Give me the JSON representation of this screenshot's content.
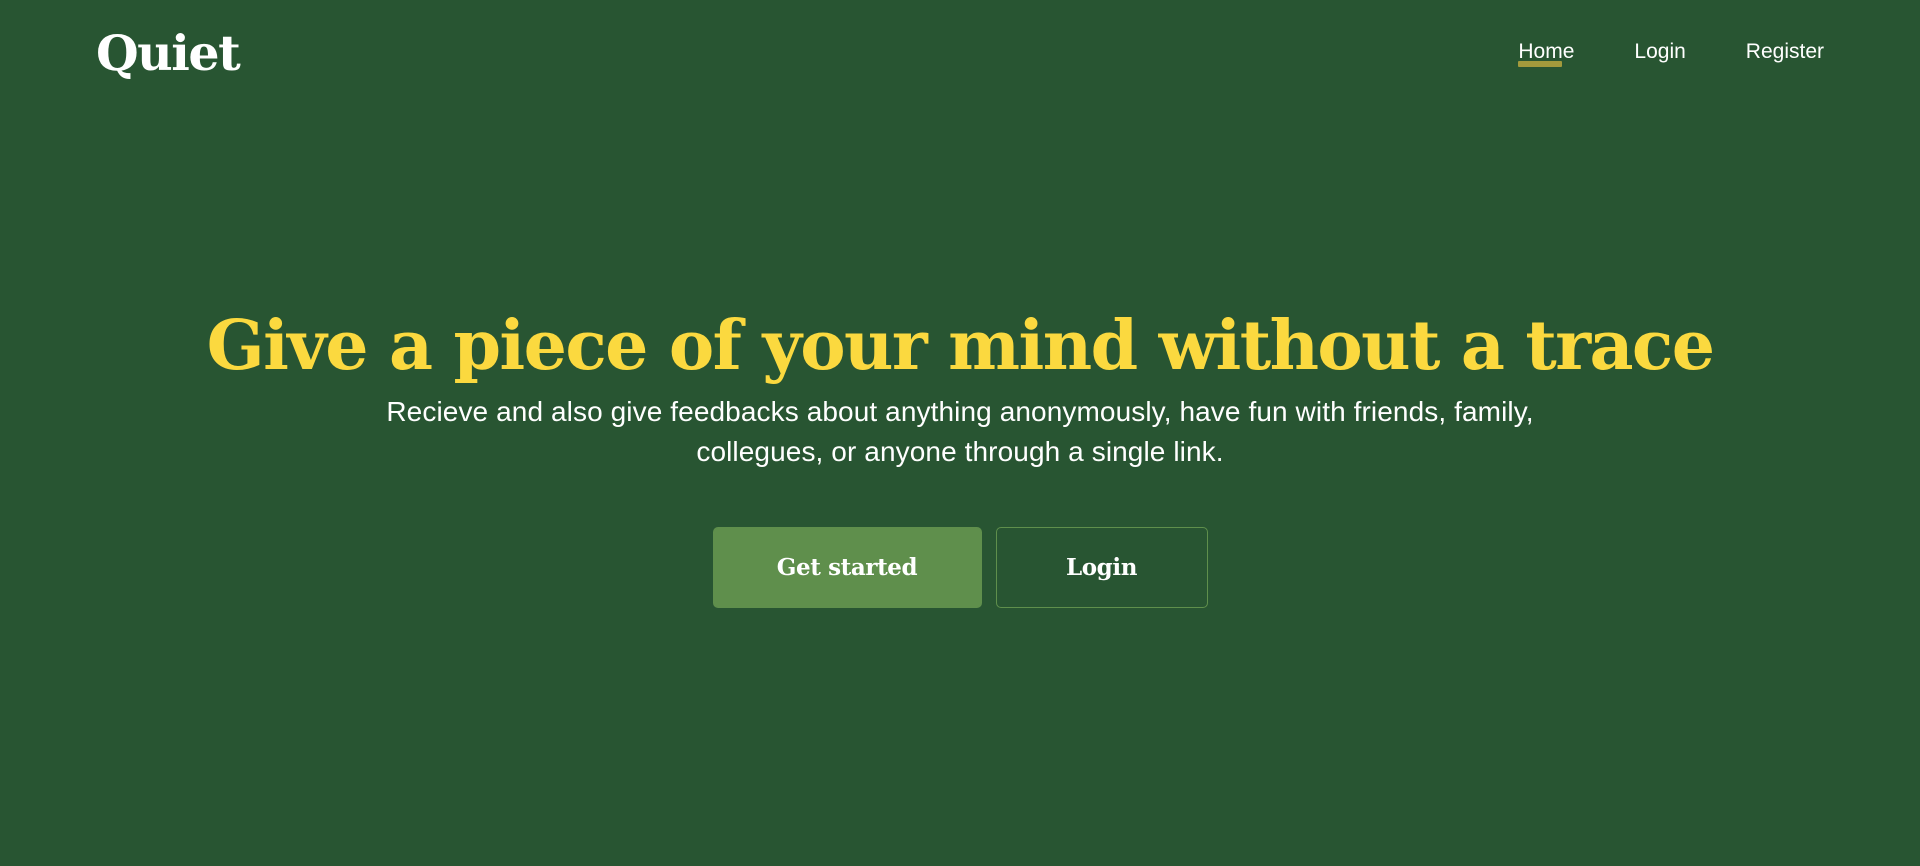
{
  "brand": {
    "name": "Quiet"
  },
  "nav": {
    "items": [
      {
        "label": "Home",
        "active": true
      },
      {
        "label": "Login",
        "active": false
      },
      {
        "label": "Register",
        "active": false
      }
    ]
  },
  "hero": {
    "title": "Give a piece of your mind without a trace",
    "subtitle": "Recieve and also give feedbacks about anything anonymously, have fun with friends, family, collegues, or anyone through a single link.",
    "primary_button": "Get started",
    "secondary_button": "Login"
  },
  "colors": {
    "background": "#285532",
    "accent_yellow": "#fbd93f",
    "button_green": "#5f8f4c",
    "active_underline": "#a39a3c"
  }
}
